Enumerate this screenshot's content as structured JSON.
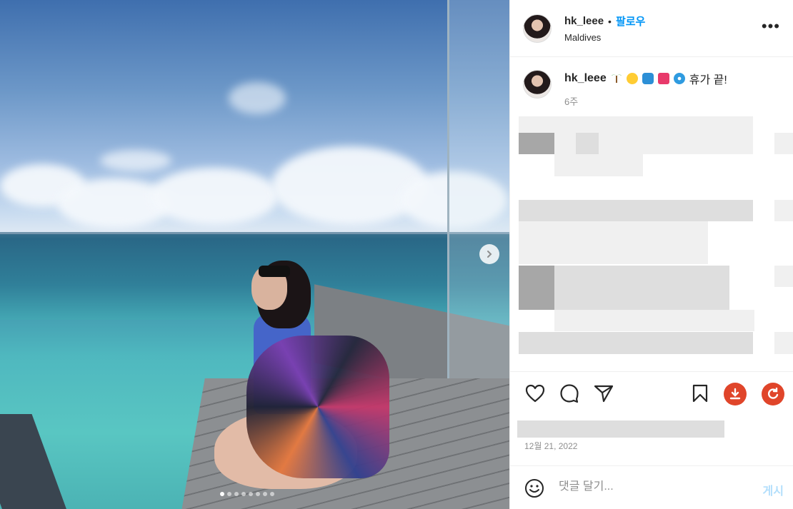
{
  "post": {
    "username": "hk_leee",
    "separator": "•",
    "follow_label": "팔로우",
    "location": "Maldives",
    "more_label": "•••",
    "carousel": {
      "total_slides": 8,
      "active_index": 0
    }
  },
  "caption": {
    "username": "hk_leee",
    "text": "휴가 끝!",
    "emoji_icons": [
      "palm-tree-icon",
      "sun-icon",
      "wave-icon",
      "bikini-icon",
      "disc-icon"
    ],
    "time_ago": "6주"
  },
  "actions": {
    "like": "heart-icon",
    "comment": "comment-icon",
    "share": "send-icon",
    "save": "bookmark-icon",
    "download": "download-icon",
    "refresh": "refresh-icon",
    "download_color": "#e0452a",
    "refresh_color": "#e0452a"
  },
  "date": "12월 21, 2022",
  "comment": {
    "placeholder": "댓글 달기...",
    "post_label": "게시"
  },
  "colors": {
    "link_blue": "#0095f6",
    "post_disabled": "#b3dffc",
    "muted": "#8e8e8e"
  }
}
